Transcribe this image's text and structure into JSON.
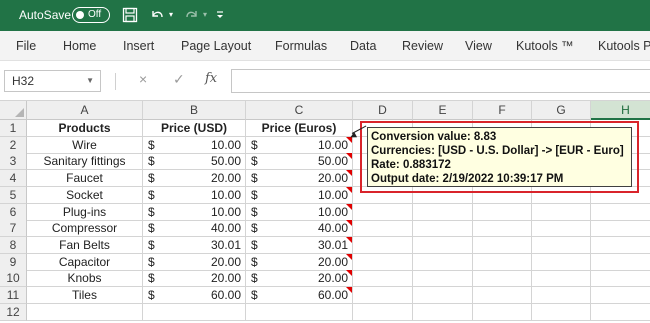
{
  "titlebar": {
    "autosave_label": "AutoSave",
    "toggle_state": "Off",
    "icons": [
      "save-icon",
      "undo-icon",
      "undo-dropdown-icon",
      "redo-icon",
      "redo-dropdown-icon",
      "customize-toolbar-icon"
    ],
    "colors": {
      "background": "#217346",
      "text": "#ffffff"
    }
  },
  "ribbon": {
    "tabs": [
      "File",
      "Home",
      "Insert",
      "Page Layout",
      "Formulas",
      "Data",
      "Review",
      "View",
      "Kutools ™",
      "Kutools P"
    ]
  },
  "formula_bar": {
    "name_box": "H32",
    "cancel_icon": "×",
    "enter_icon": "✓",
    "function_label": "fx",
    "formula": ""
  },
  "sheet": {
    "columns": [
      "A",
      "B",
      "C",
      "D",
      "E",
      "F",
      "G",
      "H"
    ],
    "selected_column": "H",
    "rows": [
      "1",
      "2",
      "3",
      "4",
      "5",
      "6",
      "7",
      "8",
      "9",
      "10",
      "11",
      "12"
    ],
    "headers": {
      "products": "Products",
      "usd": "Price (USD)",
      "euros": "Price (Euros)"
    },
    "currency_symbol": "$",
    "data": [
      {
        "product": "Wire",
        "usd": "10.00",
        "euros": "10.00"
      },
      {
        "product": "Sanitary fittings",
        "usd": "50.00",
        "euros": "50.00"
      },
      {
        "product": "Faucet",
        "usd": "20.00",
        "euros": "20.00"
      },
      {
        "product": "Socket",
        "usd": "10.00",
        "euros": "10.00"
      },
      {
        "product": "Plug-ins",
        "usd": "10.00",
        "euros": "10.00"
      },
      {
        "product": "Compressor",
        "usd": "40.00",
        "euros": "40.00"
      },
      {
        "product": "Fan Belts",
        "usd": "30.01",
        "euros": "30.01"
      },
      {
        "product": "Capacitor",
        "usd": "20.00",
        "euros": "20.00"
      },
      {
        "product": "Knobs",
        "usd": "20.00",
        "euros": "20.00"
      },
      {
        "product": "Tiles",
        "usd": "60.00",
        "euros": "60.00"
      }
    ],
    "comment_marker_color": "#e00000"
  },
  "comment": {
    "line1": "Conversion value: 8.83",
    "line2": "Currencies: [USD - U.S. Dollar] -> [EUR - Euro]",
    "line3": "Rate: 0.883172",
    "line4": "Output date: 2/19/2022 10:39:17 PM",
    "highlight_color": "#d9242b",
    "background": "#ffffe1"
  }
}
